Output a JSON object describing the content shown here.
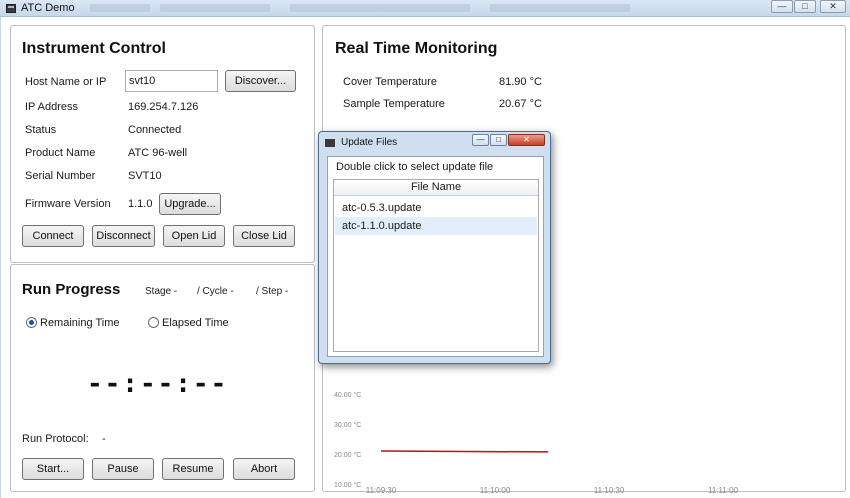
{
  "window": {
    "title": "ATC Demo"
  },
  "instrument": {
    "title": "Instrument Control",
    "host_label": "Host Name or IP",
    "host_value": "svt10",
    "discover_label": "Discover...",
    "ip_label": "IP Address",
    "ip_value": "169.254.7.126",
    "status_label": "Status",
    "status_value": "Connected",
    "product_label": "Product Name",
    "product_value": "ATC 96-well",
    "serial_label": "Serial Number",
    "serial_value": "SVT10",
    "firmware_label": "Firmware Version",
    "firmware_value": "1.1.0",
    "upgrade_label": "Upgrade...",
    "buttons": {
      "connect": "Connect",
      "disconnect": "Disconnect",
      "open_lid": "Open Lid",
      "close_lid": "Close Lid"
    }
  },
  "run": {
    "title": "Run Progress",
    "stage": "Stage  -",
    "cycle": "/ Cycle  -",
    "step": "/ Step  -",
    "remaining": "Remaining Time",
    "elapsed": "Elapsed Time",
    "remaining_selected": true,
    "timer": "--:--:--",
    "protocol_label": "Run Protocol:",
    "protocol_value": "-",
    "buttons": {
      "start": "Start...",
      "pause": "Pause",
      "resume": "Resume",
      "abort": "Abort"
    }
  },
  "monitor": {
    "title": "Real Time Monitoring",
    "cover_label": "Cover Temperature",
    "cover_value": "81.90 °C",
    "sample_label": "Sample Temperature",
    "sample_value": "20.67 °C"
  },
  "chart_data": {
    "type": "line",
    "y_ticks": [
      "40.00 °C",
      "30.00 °C",
      "20.00 °C",
      "10.00 °C"
    ],
    "x_ticks": [
      "11:09:30",
      "11:10:00",
      "11:10:30",
      "11:11:00"
    ],
    "series": [
      {
        "color": "#c01010",
        "x": [
          "11:09:30",
          "11:10:14"
        ],
        "y": [
          21.0,
          20.7
        ]
      }
    ],
    "ylim": [
      10,
      40
    ]
  },
  "dialog": {
    "title": "Update Files",
    "instruction": "Double click to select update file",
    "column": "File Name",
    "files": [
      "atc-0.5.3.update",
      "atc-1.1.0.update"
    ],
    "selected_index": 1
  }
}
